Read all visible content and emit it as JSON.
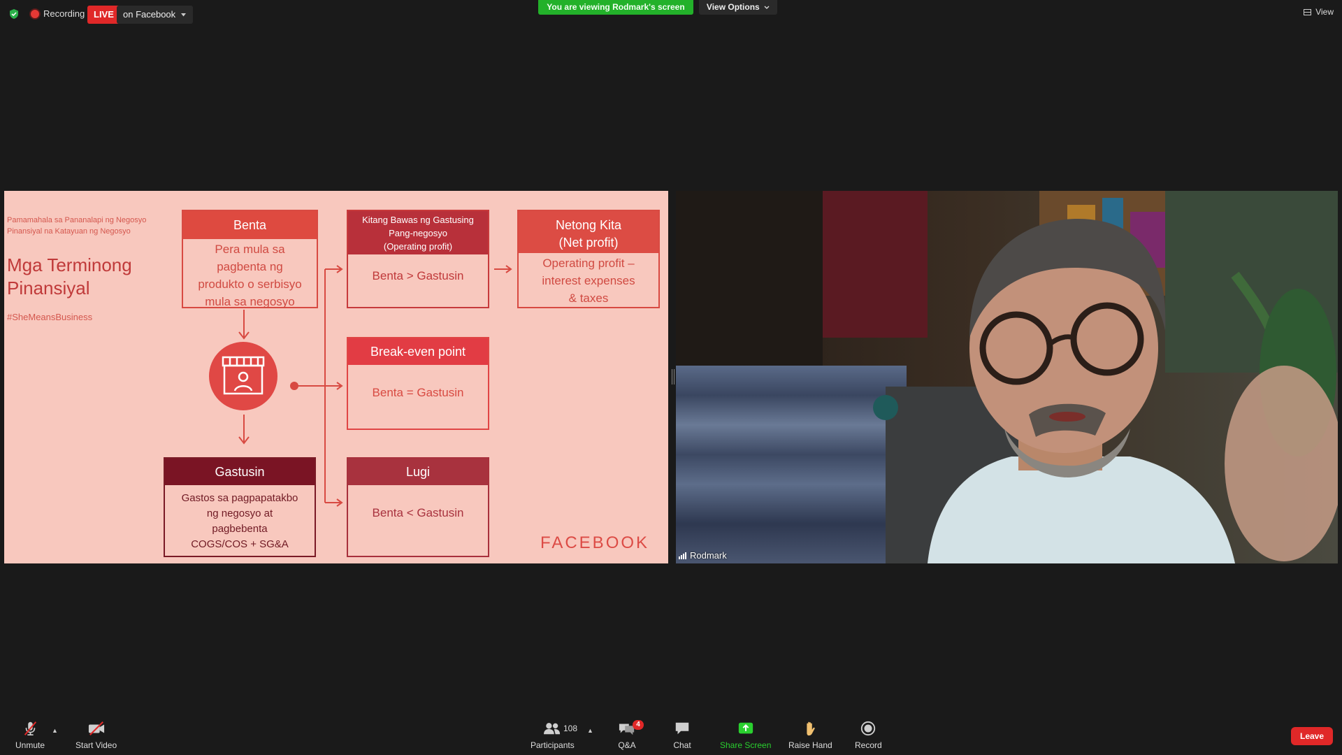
{
  "topbar": {
    "recording_label": "Recording",
    "live_label": "LIVE",
    "live_target": "on Facebook",
    "viewing_prefix": "You are viewing ",
    "viewing_name": "Rodmark's screen",
    "view_options": "View Options",
    "view_label": "View"
  },
  "slide": {
    "subtitle_line1": "Pamamahala sa Pananalapi ng Negosyo",
    "subtitle_line2": "Pinansiyal na Katayuan ng Negosyo",
    "title_line1": "Mga Terminong",
    "title_line2": "Pinansiyal",
    "hashtag": "#SheMeansBusiness",
    "benta": {
      "header": "Benta",
      "body": [
        "Pera mula sa",
        "pagbenta ng",
        "produkto o serbisyo",
        "mula sa negosyo"
      ]
    },
    "operating": {
      "header": [
        "Kitang Bawas ng Gastusing",
        "Pang-negosyo",
        "(Operating profit)"
      ],
      "body": "Benta > Gastusin"
    },
    "netong": {
      "header": [
        "Netong Kita",
        "(Net profit)"
      ],
      "body": [
        "Operating profit –",
        "interest expenses",
        "& taxes"
      ]
    },
    "breakeven": {
      "header": "Break-even point",
      "body": "Benta = Gastusin"
    },
    "gastusin": {
      "header": "Gastusin",
      "body": [
        "Gastos sa pagpapatakbo",
        "ng negosyo at",
        "pagbebenta",
        "COGS/COS + SG&A"
      ]
    },
    "lugi": {
      "header": "Lugi",
      "body": "Benta < Gastusin"
    },
    "brand": "FACEBOOK"
  },
  "video": {
    "participant_name": "Rodmark"
  },
  "toolbar": {
    "unmute": "Unmute",
    "start_video": "Start Video",
    "participants": "Participants",
    "participants_count": "108",
    "qa": "Q&A",
    "qa_badge": "4",
    "chat": "Chat",
    "share_screen": "Share Screen",
    "raise_hand": "Raise Hand",
    "record": "Record",
    "leave": "Leave"
  },
  "colors": {
    "slide_bg": "#f8c8be",
    "slide_accent": "#de4a40",
    "live_red": "#e02828",
    "share_green": "#23b12a"
  }
}
